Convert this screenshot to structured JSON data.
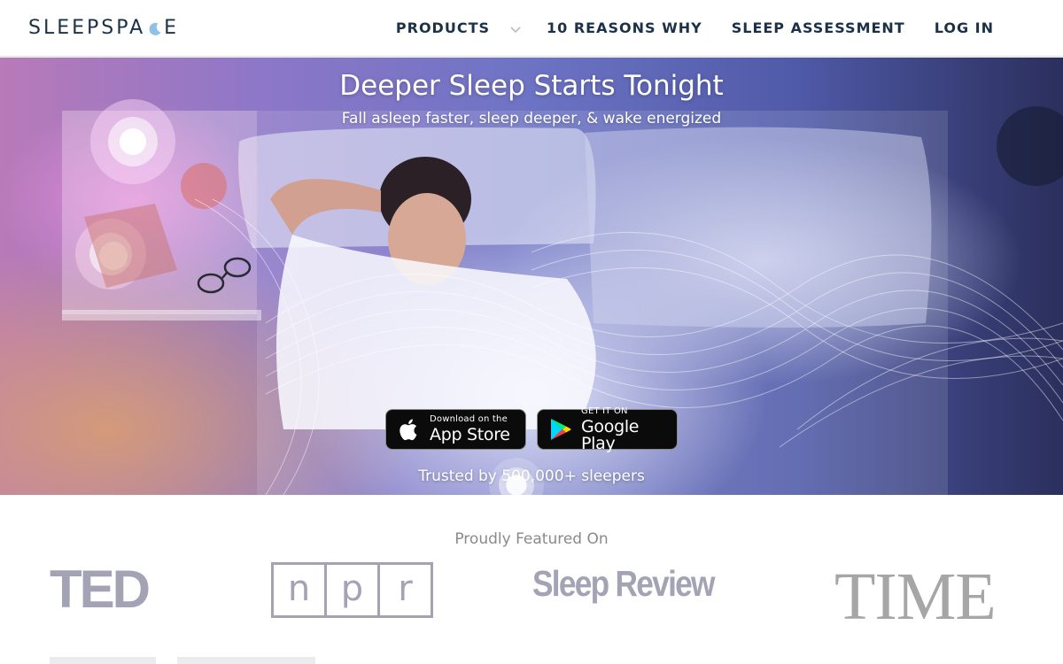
{
  "header": {
    "logo_before": "SLEEPSPA",
    "logo_after": "E",
    "nav": {
      "products": "PRODUCTS",
      "reasons": "10 REASONS WHY",
      "assessment": "SLEEP ASSESSMENT",
      "login": "LOG IN"
    }
  },
  "hero": {
    "title": "Deeper Sleep Starts Tonight",
    "subtitle": "Fall asleep faster, sleep deeper, & wake energized",
    "app_store": {
      "small": "Download on the",
      "large": "App Store"
    },
    "google_play": {
      "small": "GET IT ON",
      "large": "Google Play"
    },
    "trusted": "Trusted by 500,000+ sleepers"
  },
  "featured": {
    "label": "Proudly Featured On",
    "logos": {
      "ted": "TED",
      "npr": [
        "n",
        "p",
        "r"
      ],
      "sleep_review": "Sleep Review",
      "time": "TIME"
    }
  },
  "colors": {
    "brand_navy": "#1b3147",
    "logo_gray": "#a4a3b6",
    "button_black": "#0b0b0b"
  },
  "icons": [
    "moon-icon",
    "chevron-down-icon",
    "apple-icon",
    "google-play-icon"
  ]
}
